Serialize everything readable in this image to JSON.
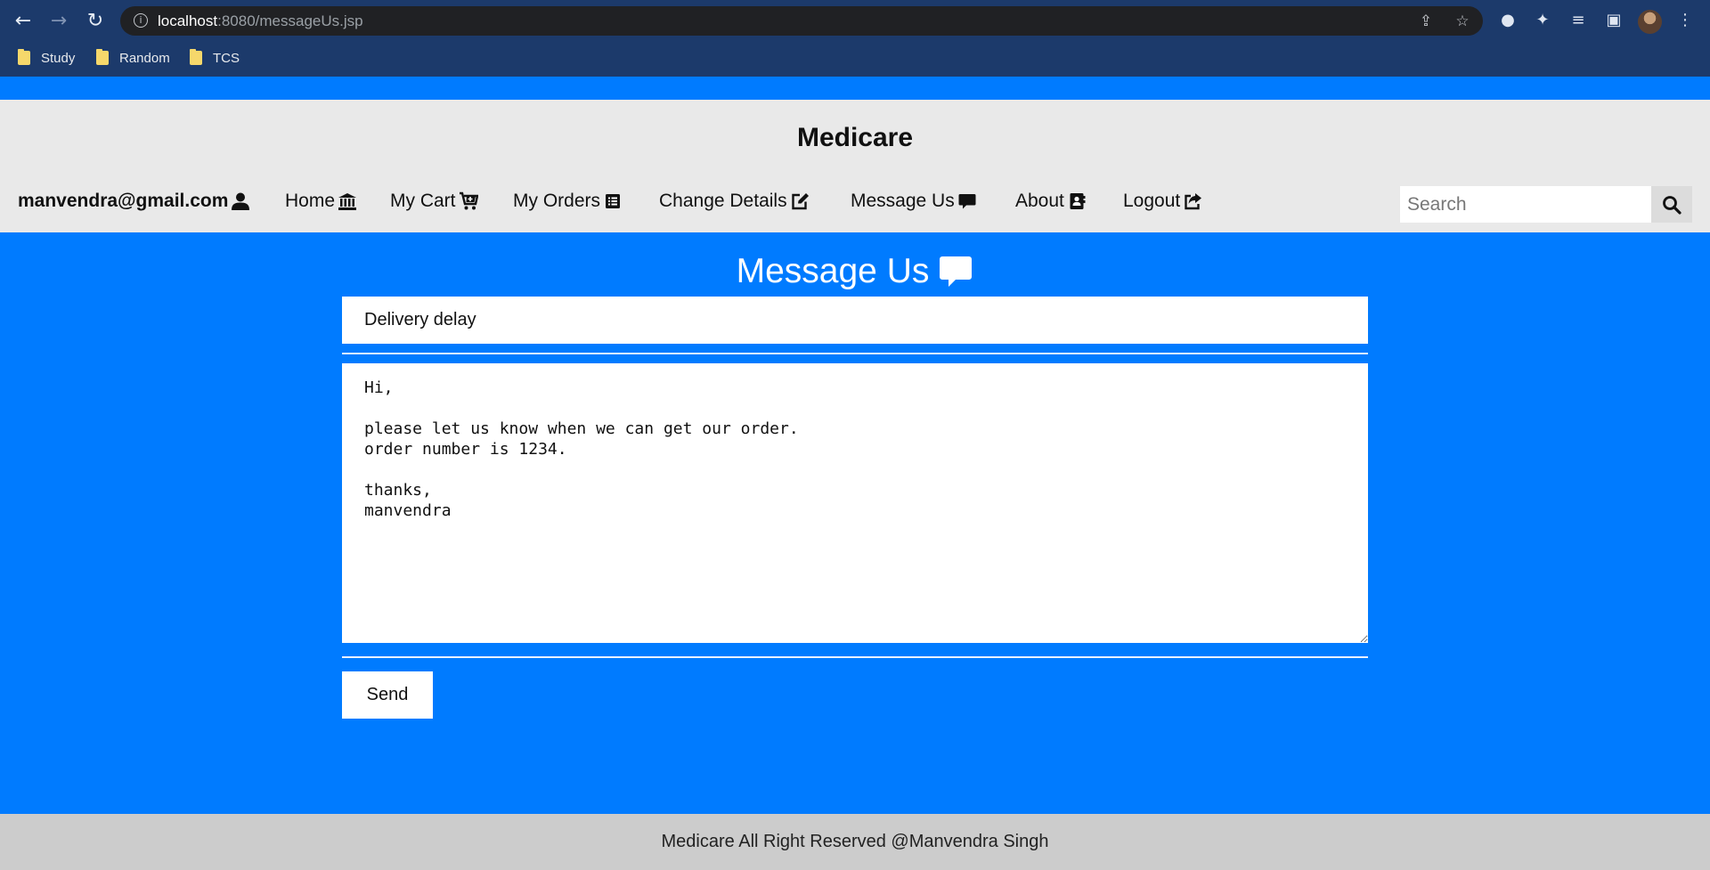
{
  "browser": {
    "url_host": "localhost",
    "url_path": ":8080/messageUs.jsp",
    "bookmarks": [
      {
        "label": "Study"
      },
      {
        "label": "Random"
      },
      {
        "label": "TCS"
      }
    ]
  },
  "header": {
    "brand": "Medicare",
    "user_email": "manvendra@gmail.com",
    "nav": {
      "home": "Home",
      "cart": "My Cart",
      "orders": "My Orders",
      "change_details": "Change Details",
      "message_us": "Message Us",
      "about": "About",
      "logout": "Logout"
    },
    "search": {
      "placeholder": "Search",
      "value": ""
    }
  },
  "form": {
    "title": "Message Us",
    "subject_value": "Delivery delay",
    "message_value": "Hi,\n\nplease let us know when we can get our order.\norder number is 1234.\n\nthanks,\nmanvendra",
    "send_label": "Send"
  },
  "footer": {
    "text": "Medicare All Right Reserved @Manvendra Singh"
  },
  "colors": {
    "page_bg": "#007bff",
    "header_bg": "#e9e9e9",
    "footer_bg": "#cccccc",
    "chrome_bg": "#1c3a6b"
  }
}
